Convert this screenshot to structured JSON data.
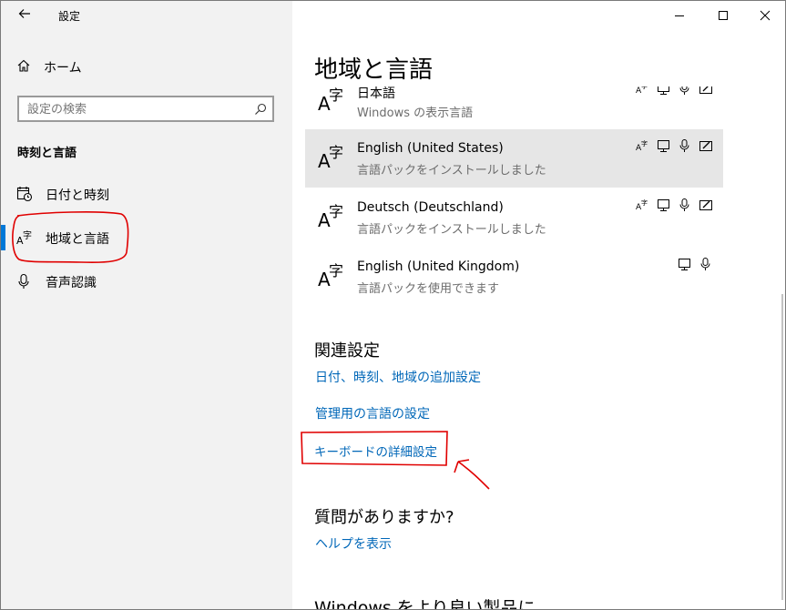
{
  "window": {
    "app_title": "設定"
  },
  "sidebar": {
    "home_label": "ホーム",
    "search_placeholder": "設定の検索",
    "section_heading": "時刻と言語",
    "items": [
      {
        "label": "日付と時刻",
        "icon": "calendar-clock-icon"
      },
      {
        "label": "地域と言語",
        "icon": "language-glyph-icon",
        "selected": true
      },
      {
        "label": "音声認識",
        "icon": "microphone-icon"
      }
    ]
  },
  "main": {
    "title": "地域と言語",
    "languages": [
      {
        "name": "日本語",
        "status": "Windows の表示言語",
        "features": [
          "text-to-speech-icon",
          "display-icon",
          "mic-icon",
          "handwriting-icon"
        ]
      },
      {
        "name": "English (United States)",
        "status": "言語パックをインストールしました",
        "selected": true,
        "features": [
          "text-to-speech-icon",
          "display-icon",
          "mic-icon",
          "handwriting-icon"
        ]
      },
      {
        "name": "Deutsch (Deutschland)",
        "status": "言語パックをインストールしました",
        "features": [
          "text-to-speech-icon",
          "display-icon",
          "mic-icon",
          "handwriting-icon"
        ]
      },
      {
        "name": "English (United Kingdom)",
        "status": "言語パックを使用できます",
        "features": [
          "display-icon",
          "mic-icon"
        ]
      }
    ],
    "related_heading": "関連設定",
    "related_links": [
      "日付、時刻、地域の追加設定",
      "管理用の言語の設定",
      "キーボードの詳細設定"
    ],
    "question_heading": "質問がありますか?",
    "help_link": "ヘルプを表示",
    "bottom_heading": "Windows をより良い製品に"
  },
  "colors": {
    "accent": "#0078d7",
    "link": "#0067b8",
    "annotation": "#e00000"
  }
}
